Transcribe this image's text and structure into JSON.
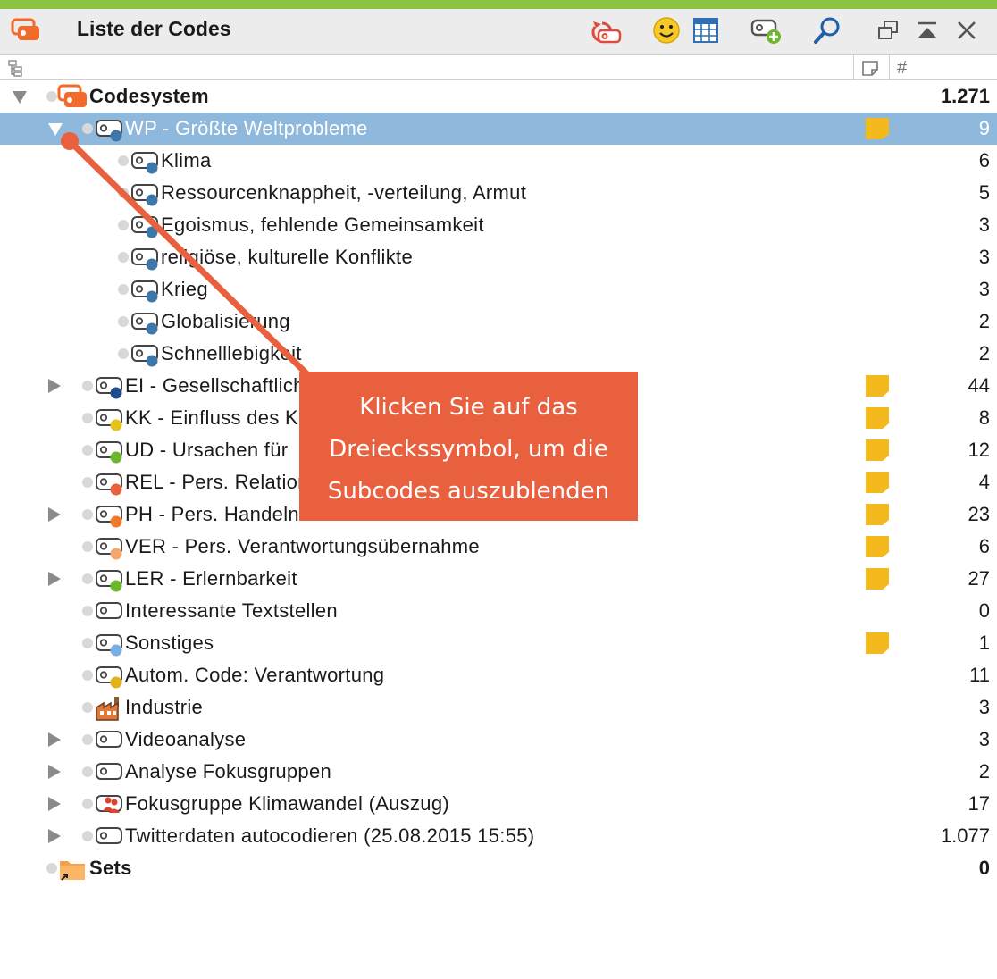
{
  "window": {
    "title": "Liste der Codes",
    "toolbar": [
      {
        "name": "code-history-icon"
      },
      {
        "name": "emoticode-icon"
      },
      {
        "name": "code-matrix-icon"
      },
      {
        "name": "new-code-icon"
      },
      {
        "name": "search-icon"
      },
      {
        "name": "undock-window-icon"
      },
      {
        "name": "collapse-window-icon"
      },
      {
        "name": "close-icon"
      }
    ]
  },
  "columns": {
    "tree_icon": "code-tree-icon",
    "memo_icon": "memo-column-icon",
    "count_icon": "#"
  },
  "colors": {
    "accent_bar": "#8bc440",
    "selection": "#8fb8dd",
    "memo": "#f4b91c",
    "callout": "#e8603e"
  },
  "tree": [
    {
      "label": "Codesystem",
      "count": "1.271",
      "icon": "codesystem-icon",
      "bold": true,
      "level": 0,
      "expander": "down"
    },
    {
      "label": "WP - Größte Weltprobleme",
      "count": "9",
      "icon": "code-icon",
      "color": "#3f76a8",
      "level": 1,
      "expander": "down",
      "memo": true,
      "selected": true
    },
    {
      "label": "Klima",
      "count": "6",
      "icon": "code-icon",
      "color": "#3f76a8",
      "level": 2
    },
    {
      "label": "Ressourcenknappheit, -verteilung, Armut",
      "count": "5",
      "icon": "code-icon",
      "color": "#3f76a8",
      "level": 2
    },
    {
      "label": "Egoismus, fehlende Gemeinsamkeit",
      "count": "3",
      "icon": "code-icon",
      "color": "#3f76a8",
      "level": 2
    },
    {
      "label": "religiöse, kulturelle Konflikte",
      "count": "3",
      "icon": "code-icon",
      "color": "#3f76a8",
      "level": 2
    },
    {
      "label": "Krieg",
      "count": "3",
      "icon": "code-icon",
      "color": "#3f76a8",
      "level": 2
    },
    {
      "label": "Globalisierung",
      "count": "2",
      "icon": "code-icon",
      "color": "#3f76a8",
      "level": 2
    },
    {
      "label": "Schnelllebigkeit",
      "count": "2",
      "icon": "code-icon",
      "color": "#3f76a8",
      "level": 2
    },
    {
      "label": "EI - Gesellschaftliche",
      "count": "44",
      "icon": "code-icon",
      "color": "#1f4e8a",
      "level": 1,
      "expander": "right",
      "memo": true
    },
    {
      "label": "KK - Einfluss des K",
      "count": "8",
      "icon": "code-icon",
      "color": "#e8c21c",
      "level": 1,
      "memo": true
    },
    {
      "label": "UD - Ursachen für",
      "count": "12",
      "icon": "code-icon",
      "color": "#6cb52d",
      "level": 1,
      "memo": true
    },
    {
      "label": "REL - Pers. Relation",
      "count": "4",
      "icon": "code-icon",
      "color": "#e8603e",
      "level": 1,
      "memo": true
    },
    {
      "label": "PH - Pers. Handeln",
      "count": "23",
      "icon": "code-icon",
      "color": "#ec7a2a",
      "level": 1,
      "expander": "right",
      "memo": true
    },
    {
      "label": "VER - Pers. Verantwortungsübernahme",
      "count": "6",
      "icon": "code-icon",
      "color": "#f5a76b",
      "level": 1,
      "memo": true
    },
    {
      "label": "LER - Erlernbarkeit",
      "count": "27",
      "icon": "code-icon",
      "color": "#6cb52d",
      "level": 1,
      "expander": "right",
      "memo": true
    },
    {
      "label": "Interessante Textstellen",
      "count": "0",
      "icon": "code-icon-plain",
      "level": 1
    },
    {
      "label": "Sonstiges",
      "count": "1",
      "icon": "code-icon",
      "color": "#7aaee0",
      "level": 1,
      "memo": true
    },
    {
      "label": "Autom. Code: Verantwortung",
      "count": "11",
      "icon": "code-icon",
      "color": "#e0b21c",
      "level": 1
    },
    {
      "label": "Industrie",
      "count": "3",
      "icon": "factory-icon",
      "level": 1
    },
    {
      "label": "Videoanalyse",
      "count": "3",
      "icon": "code-icon-plain",
      "level": 1,
      "expander": "right"
    },
    {
      "label": "Analyse Fokusgruppen",
      "count": "2",
      "icon": "code-icon-plain",
      "level": 1,
      "expander": "right"
    },
    {
      "label": "Fokusgruppe Klimawandel (Auszug)",
      "count": "17",
      "icon": "focus-group-icon",
      "level": 1,
      "expander": "right"
    },
    {
      "label": "Twitterdaten autocodieren (25.08.2015 15:55)",
      "count": "1.077",
      "icon": "code-icon-plain",
      "level": 1,
      "expander": "right"
    },
    {
      "label": "Sets",
      "count": "0",
      "icon": "sets-folder-icon",
      "bold": true,
      "level": 0
    }
  ],
  "callout": {
    "lines": [
      "Klicken Sie auf das",
      "Dreieckssymbol, um die",
      "Subcodes auszublenden"
    ]
  }
}
